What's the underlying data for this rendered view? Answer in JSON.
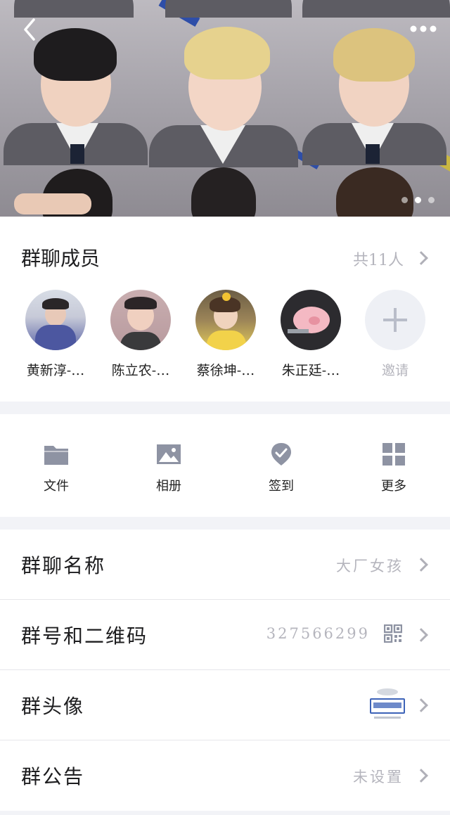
{
  "header": {
    "back_icon": "chevron-left-icon",
    "more_icon": "more-dots-icon",
    "carousel_pages": 3,
    "carousel_active": 2
  },
  "members": {
    "title": "群聊成员",
    "count": "共11人",
    "list": [
      {
        "name": "黄新淳-…"
      },
      {
        "name": "陈立农-…"
      },
      {
        "name": "蔡徐坤-…"
      },
      {
        "name": "朱正廷-…"
      }
    ],
    "invite_label": "邀请"
  },
  "tools": [
    {
      "label": "文件",
      "icon": "folder-icon"
    },
    {
      "label": "相册",
      "icon": "image-icon"
    },
    {
      "label": "签到",
      "icon": "check-in-icon"
    },
    {
      "label": "更多",
      "icon": "grid-icon"
    }
  ],
  "settings": {
    "name": {
      "title": "群聊名称",
      "value": "大厂女孩"
    },
    "number": {
      "title": "群号和二维码",
      "value": "327566299"
    },
    "avatar": {
      "title": "群头像"
    },
    "notice": {
      "title": "群公告",
      "value": "未设置"
    }
  },
  "colors": {
    "muted_text": "#b5b5bd",
    "icon_gray": "#8e93a3",
    "background": "#f2f3f7"
  }
}
